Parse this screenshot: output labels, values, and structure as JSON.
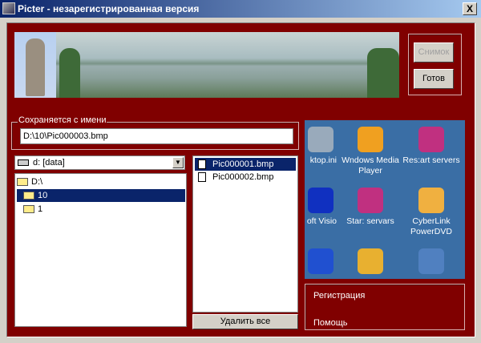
{
  "window": {
    "title": "Picter - незарегистрированная версия",
    "close": "X"
  },
  "buttons": {
    "snapshot": "Снимок",
    "ready": "Готов",
    "delete_all": "Удалить все"
  },
  "save": {
    "label": "Сохраняется с имени",
    "value": "D:\\10\\Pic000003.bmp"
  },
  "drive": {
    "value": "d: [data]",
    "arrow": "▼"
  },
  "tree": [
    {
      "label": "D:\\"
    },
    {
      "label": "10"
    },
    {
      "label": "1"
    }
  ],
  "files": [
    {
      "name": "Pic000001.bmp"
    },
    {
      "name": "Pic000002.bmp"
    }
  ],
  "desktop": [
    {
      "label": "ktop.ini",
      "icon": "ini-file-icon",
      "color": "#9ab"
    },
    {
      "label": "Wndows Media Player",
      "icon": "media-player-icon",
      "color": "#f0a020"
    },
    {
      "label": "Res:art servers",
      "icon": "restart-servers-icon",
      "color": "#c03080"
    },
    {
      "label": "oft Visio",
      "icon": "visio-icon",
      "color": "#1030c0"
    },
    {
      "label": "Star: servars",
      "icon": "start-servers-icon",
      "color": "#c03080"
    },
    {
      "label": "CyberLink PowerDVD",
      "icon": "powerdvd-icon",
      "color": "#f0b040"
    },
    {
      "label": "",
      "icon": "app-icon",
      "color": "#2050d0"
    },
    {
      "label": "",
      "icon": "app-icon",
      "color": "#e8b030"
    },
    {
      "label": "",
      "icon": "app-icon",
      "color": "#5080c0"
    }
  ],
  "links": {
    "register": "Регистрация",
    "help": "Помощь"
  }
}
